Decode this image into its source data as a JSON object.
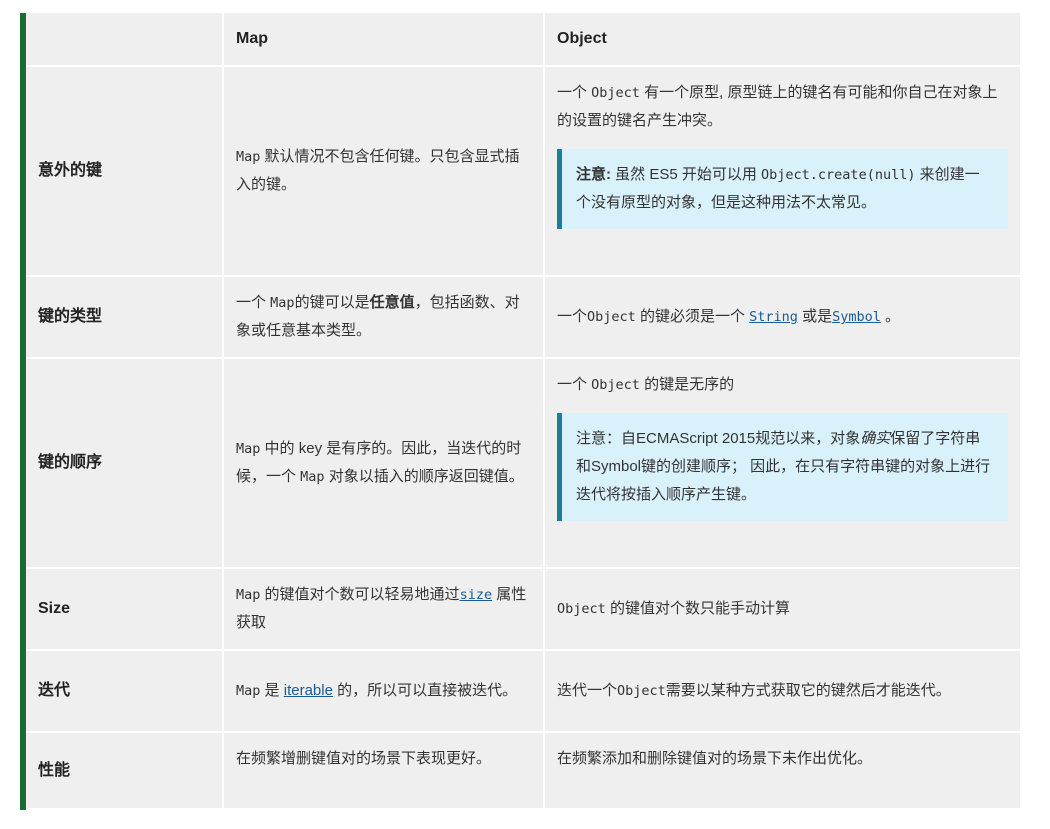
{
  "header": {
    "col1": "Map",
    "col2": "Object"
  },
  "rows": {
    "accidental_keys": {
      "label": "意外的键",
      "map": {
        "code": "Map",
        "text": " 默认情况不包含任何键。只包含显式插入的键。"
      },
      "object": {
        "pre": "一个 ",
        "code": "Object",
        "post": " 有一个原型, 原型链上的键名有可能和你自己在对象上的设置的键名产生冲突。",
        "note_strong": "注意:",
        "note_pre": " 虽然 ES5 开始可以用 ",
        "note_code": "Object.create(null)",
        "note_post": " 来创建一个没有原型的对象，但是这种用法不太常见。"
      }
    },
    "key_types": {
      "label": "键的类型",
      "map": {
        "pre": "一个 ",
        "code": "Map",
        "mid": "的键可以是",
        "strong": "任意值",
        "post": "，包括函数、对象或任意基本类型。"
      },
      "object": {
        "pre": "一个",
        "code": "Object",
        "mid": " 的键必须是一个 ",
        "link1": "String",
        "mid2": " 或是",
        "link2": "Symbol",
        "post": " 。"
      }
    },
    "key_order": {
      "label": "键的顺序",
      "map": {
        "code1": "Map",
        "mid1": " 中的 key 是有序的。因此，当迭代的时候，一个 ",
        "code2": "Map",
        "post": " 对象以插入的顺序返回键值。"
      },
      "object": {
        "pre": "一个 ",
        "code": "Object",
        "post": " 的键是无序的",
        "note_pre": "注意：自ECMAScript 2015规范以来，对象",
        "note_em": "确实",
        "note_post": "保留了字符串和Symbol键的创建顺序； 因此，在只有字符串键的对象上进行迭代将按插入顺序产生键。"
      }
    },
    "size": {
      "label": "Size",
      "map": {
        "code": "Map",
        "mid": " 的键值对个数可以轻易地通过",
        "link": "size",
        "post": " 属性获取"
      },
      "object": {
        "code": "Object",
        "post": " 的键值对个数只能手动计算"
      }
    },
    "iteration": {
      "label": "迭代",
      "map": {
        "code": "Map",
        "mid": " 是 ",
        "link": "iterable",
        "post": " 的，所以可以直接被迭代。"
      },
      "object": {
        "pre": "迭代一个",
        "code": "Object",
        "post": "需要以某种方式获取它的键然后才能迭代。"
      }
    },
    "performance": {
      "label": "性能",
      "map": {
        "text": "在频繁增删键值对的场景下表现更好。"
      },
      "object": {
        "text": "在频繁添加和删除键值对的场景下未作出优化。"
      }
    }
  }
}
